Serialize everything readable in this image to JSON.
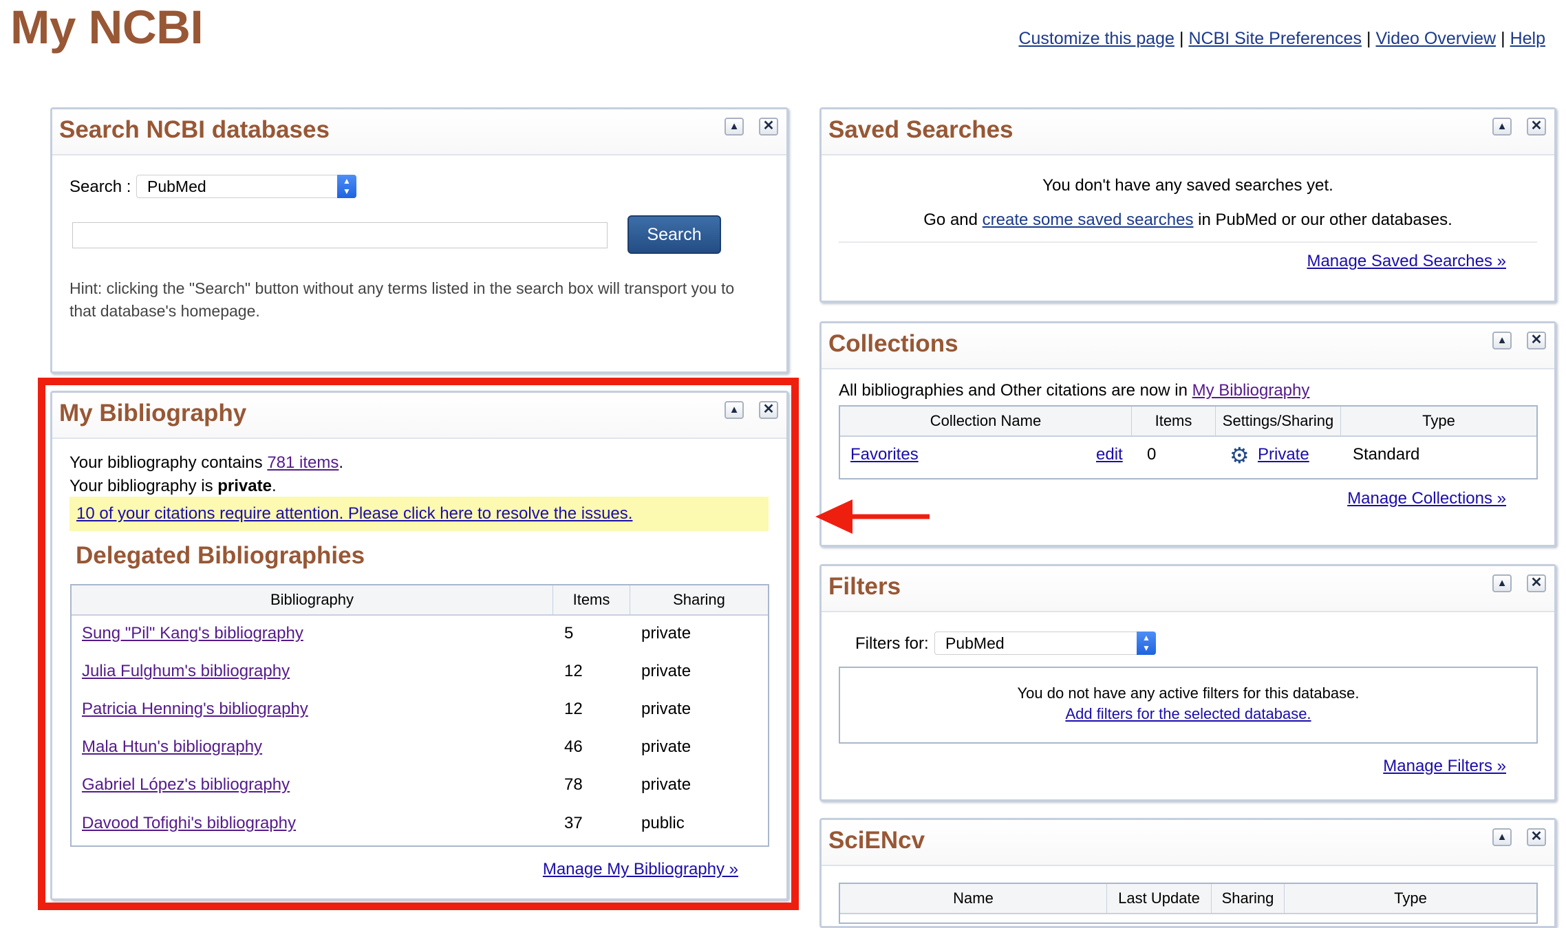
{
  "page": {
    "title": "My NCBI",
    "top_links": [
      "Customize this page",
      "NCBI Site Preferences",
      "Video Overview",
      "Help"
    ],
    "separator": "|"
  },
  "search_portlet": {
    "title": "Search NCBI databases",
    "search_label": "Search :",
    "db_selected": "PubMed",
    "query_value": "",
    "button_label": "Search",
    "hint": "Hint: clicking the \"Search\" button without any terms listed in the search box will transport you to that database's homepage."
  },
  "bibliography_portlet": {
    "title": "My Bibliography",
    "contains_prefix": "Your bibliography contains ",
    "items_link": "781 items",
    "contains_suffix": ".",
    "status_prefix": "Your bibliography is ",
    "status_value": "private",
    "status_suffix": ".",
    "attention_link": "10 of your citations require attention. Please click here to resolve the issues.",
    "delegated_title": "Delegated Bibliographies",
    "columns": [
      "Bibliography",
      "Items",
      "Sharing"
    ],
    "rows": [
      {
        "name": "Sung \"Pil\" Kang's bibliography",
        "items": "5",
        "sharing": "private"
      },
      {
        "name": "Julia Fulghum's bibliography",
        "items": "12",
        "sharing": "private"
      },
      {
        "name": "Patricia Henning's bibliography",
        "items": "12",
        "sharing": "private"
      },
      {
        "name": "Mala Htun's bibliography",
        "items": "46",
        "sharing": "private"
      },
      {
        "name": "Gabriel López's bibliography",
        "items": "78",
        "sharing": "private"
      },
      {
        "name": "Davood Tofighi's bibliography",
        "items": "37",
        "sharing": "public"
      }
    ],
    "manage_link": "Manage My Bibliography »"
  },
  "saved_searches_portlet": {
    "title": "Saved Searches",
    "empty_message": "You don't have any saved searches yet.",
    "go_prefix": "Go and ",
    "go_link": "create some saved searches",
    "go_suffix": " in PubMed or our other databases.",
    "manage_link": "Manage Saved Searches »"
  },
  "collections_portlet": {
    "title": "Collections",
    "info_prefix": "All bibliographies and Other citations are now in ",
    "info_link": "My Bibliography",
    "columns": [
      "Collection Name",
      "Items",
      "Settings/Sharing",
      "Type"
    ],
    "rows": [
      {
        "name": "Favorites",
        "edit": "edit",
        "items": "0",
        "sharing": "Private",
        "type": "Standard"
      }
    ],
    "manage_link": "Manage Collections »"
  },
  "filters_portlet": {
    "title": "Filters",
    "filters_for_label": "Filters for:",
    "db_selected": "PubMed",
    "empty_message": "You do not have any active filters for this database.",
    "add_link": "Add filters for the selected database.",
    "manage_link": "Manage Filters »"
  },
  "sciencv_portlet": {
    "title": "SciENcv",
    "columns": [
      "Name",
      "Last Update",
      "Sharing",
      "Type"
    ]
  },
  "colors": {
    "title_brown": "#985735",
    "link_blue": "#1a0dab",
    "link_visited": "#551a8b",
    "highlight_red": "#ef1f10",
    "attention_yellow": "#fcf9b0"
  },
  "icons": [
    "collapse-icon",
    "close-icon",
    "gear-icon",
    "select-arrow-icon",
    "red-arrow-icon"
  ]
}
